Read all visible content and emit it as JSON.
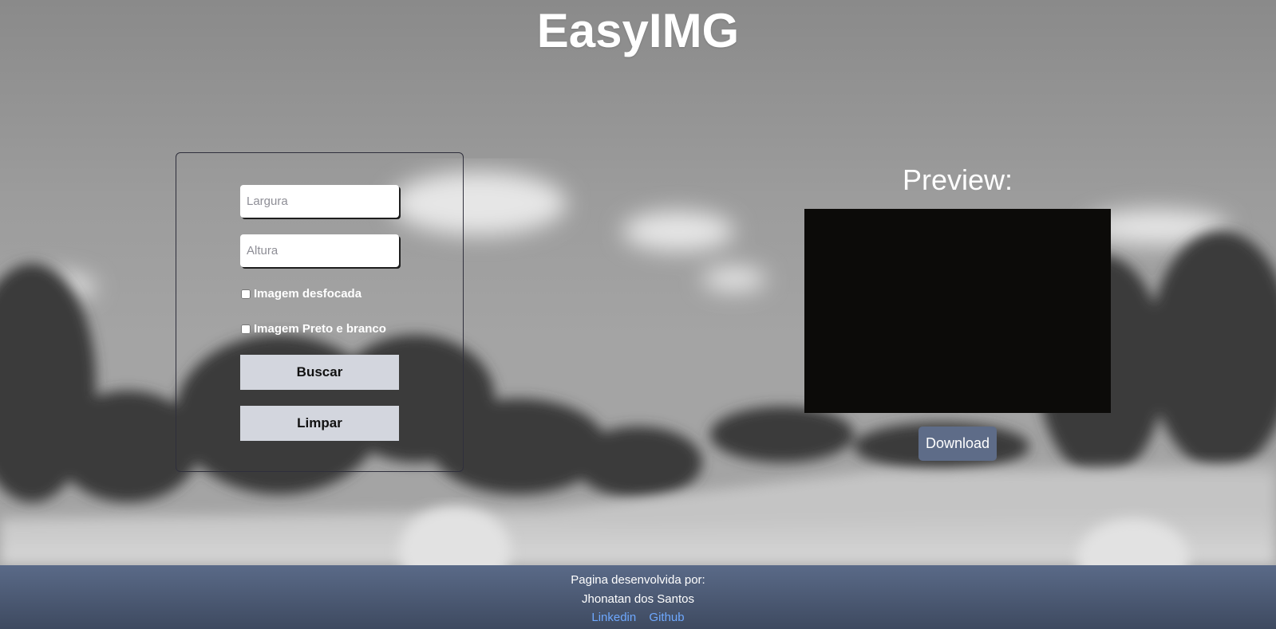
{
  "app": {
    "title": "EasyIMG"
  },
  "form": {
    "width_placeholder": "Largura",
    "height_placeholder": "Altura",
    "blur_label": "Imagem desfocada",
    "blur_checked": false,
    "grayscale_label": "Imagem Preto e branco",
    "grayscale_checked": false,
    "search_label": "Buscar",
    "clear_label": "Limpar"
  },
  "preview": {
    "title": "Preview:",
    "download_label": "Download"
  },
  "footer": {
    "developed_by": "Pagina desenvolvida por:",
    "author": "Jhonatan dos Santos",
    "links": [
      {
        "label": "Linkedin"
      },
      {
        "label": "Github"
      }
    ]
  },
  "colors": {
    "footer_bg": "#5a6a88",
    "button_bg": "#d3d6de",
    "download_bg": "#5e6c88",
    "link": "#6ea8ff",
    "preview_bg": "#0c0b09"
  }
}
